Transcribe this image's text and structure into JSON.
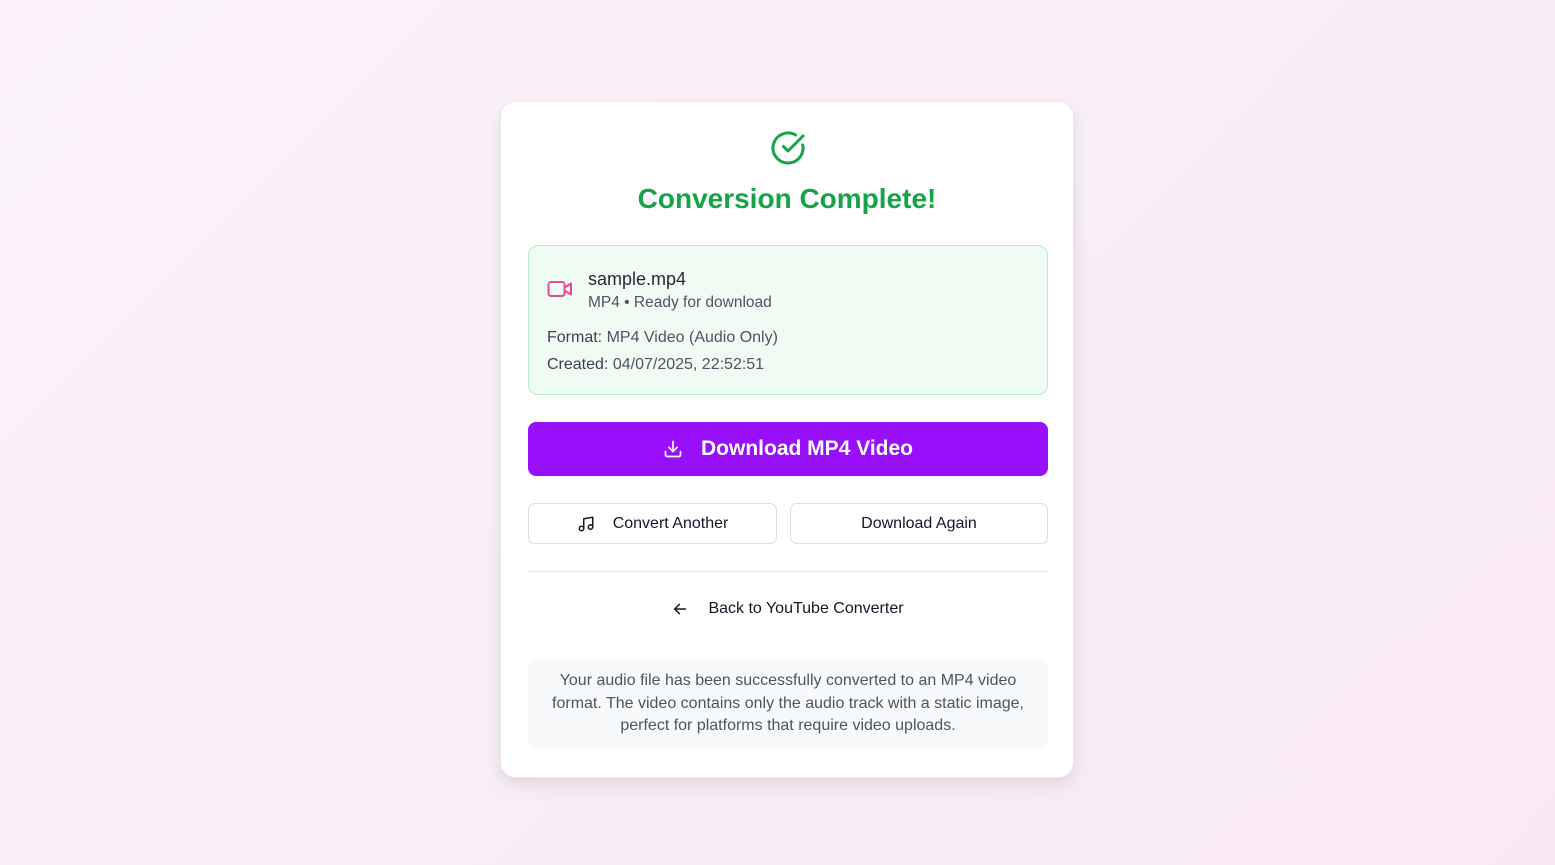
{
  "header": {
    "title": "Conversion Complete!"
  },
  "file": {
    "name": "sample.mp4",
    "status": "MP4 • Ready for download",
    "format_label": "Format:",
    "format_value": "MP4 Video (Audio Only)",
    "created_label": "Created:",
    "created_value": "04/07/2025, 22:52:51"
  },
  "actions": {
    "download_label": "Download MP4 Video",
    "convert_another_label": "Convert Another",
    "download_again_label": "Download Again",
    "back_label": "Back to YouTube Converter"
  },
  "info": {
    "text": "Your audio file has been successfully converted to an MP4 video format. The video contains only the audio track with a static image, perfect for platforms that require video uploads."
  },
  "icons": {
    "success": "check-circle-icon",
    "file": "video-camera-icon",
    "download": "download-icon",
    "convert": "music-note-icon",
    "back": "arrow-left-icon"
  },
  "colors": {
    "success_green": "#16a34a",
    "primary_purple": "#9810fa",
    "file_icon_pink": "#ec4899",
    "file_box_bg": "#effcf4"
  }
}
